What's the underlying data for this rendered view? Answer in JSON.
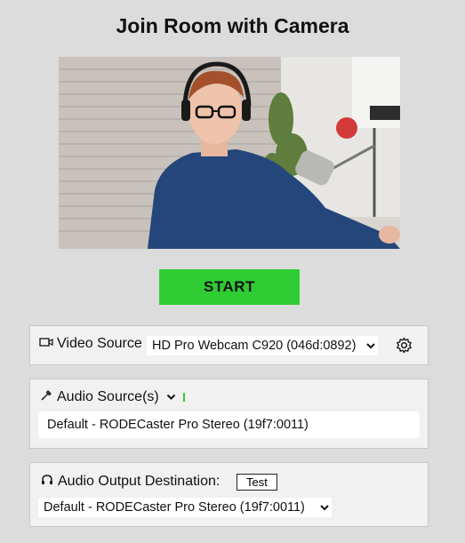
{
  "page": {
    "title": "Join Room with Camera"
  },
  "actions": {
    "start_label": "START"
  },
  "video": {
    "label": "Video Source",
    "selected": "HD Pro Webcam C920 (046d:0892)",
    "icon": "video-camera-icon",
    "settings_icon": "gear-icon"
  },
  "audio_source": {
    "label": "Audio Source(s)",
    "icon": "microphone-icon",
    "value": "Default - RODECaster Pro Stereo (19f7:0011)"
  },
  "audio_output": {
    "label": "Audio Output Destination:",
    "icon": "headphones-icon",
    "test_label": "Test",
    "selected": "Default - RODECaster Pro Stereo (19f7:0011)"
  },
  "colors": {
    "start_button": "#2fcc34",
    "background": "#dcdcdc",
    "panel": "#f1f1f1",
    "level_meter": "#2fcc34"
  }
}
